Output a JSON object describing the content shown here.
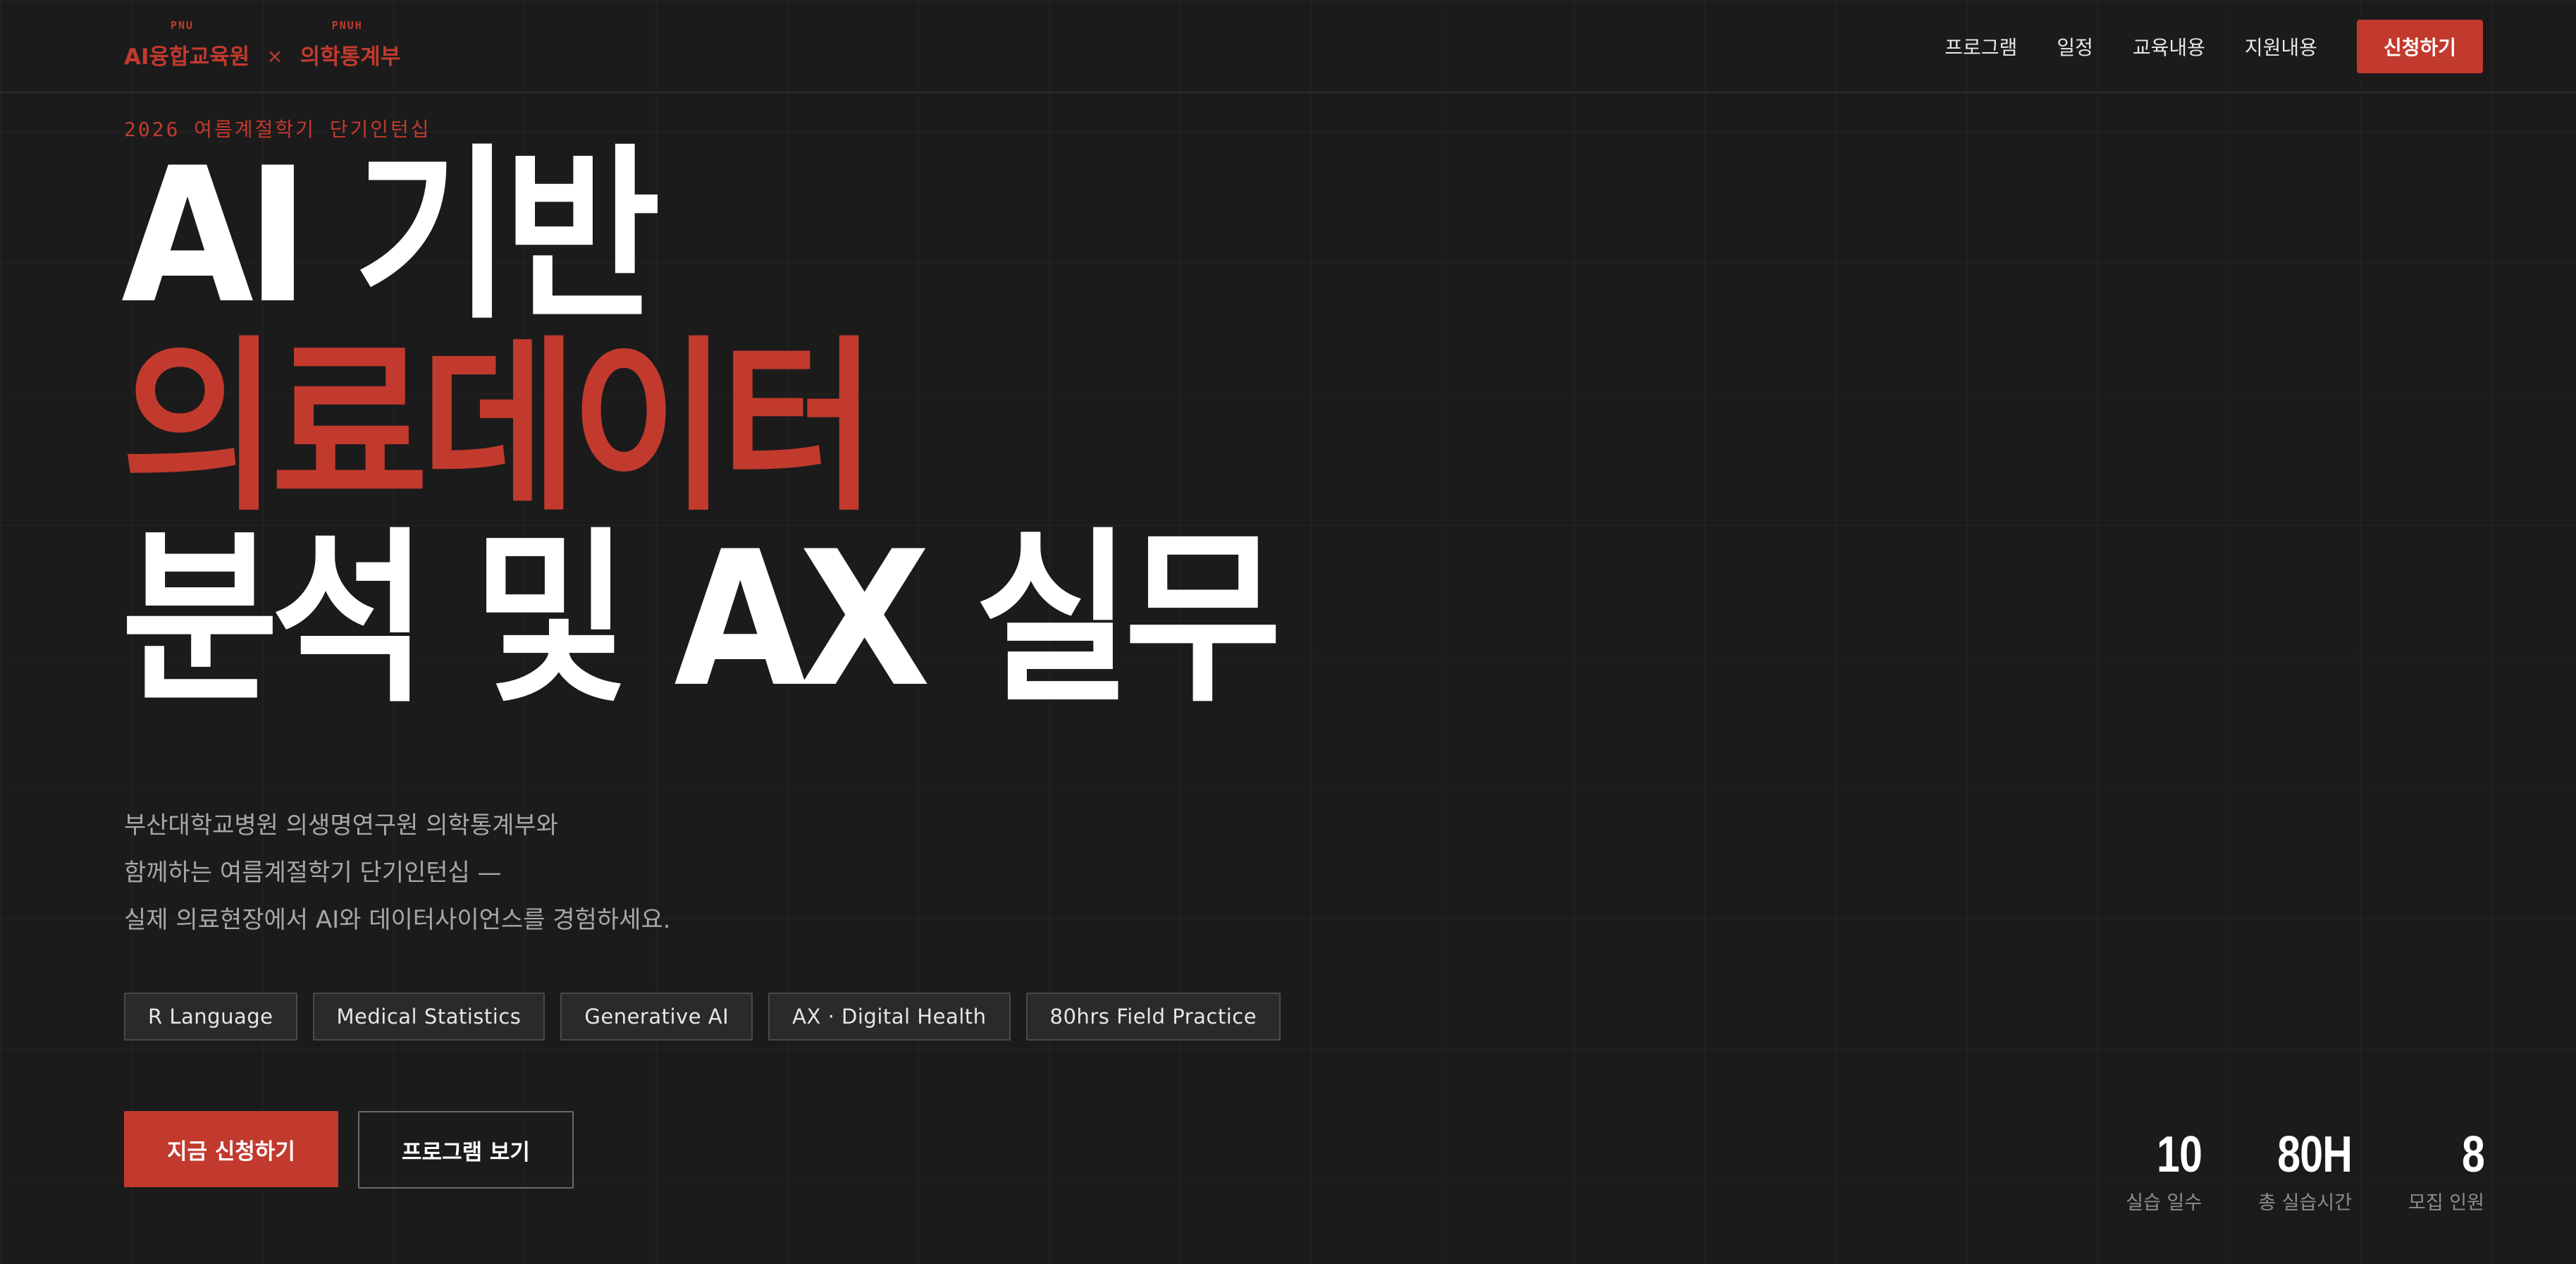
{
  "header": {
    "logo": {
      "left_tag": "PNU",
      "left_name": "AI융합교육원",
      "separator": "×",
      "right_tag": "PNUH",
      "right_name": "의학통계부"
    },
    "nav": {
      "items": [
        "프로그램",
        "일정",
        "교육내용",
        "지원내용"
      ],
      "apply_label": "신청하기"
    }
  },
  "hero": {
    "eyebrow": "2026 여름계절학기 단기인턴십",
    "title_line1": "AI 기반",
    "title_line2": "의료데이터",
    "title_line3": "분석 및 AX 실무",
    "description": [
      "부산대학교병원 의생명연구원 의학통계부와",
      "함께하는 여름계절학기 단기인턴십 —",
      "실제 의료현장에서 AI와 데이터사이언스를 경험하세요."
    ],
    "tags": [
      "R Language",
      "Medical Statistics",
      "Generative AI",
      "AX · Digital Health",
      "80hrs Field Practice"
    ],
    "primary_button": "지금 신청하기",
    "secondary_button": "프로그램 보기"
  },
  "stats": [
    {
      "value": "10",
      "label": "실습 일수"
    },
    {
      "value": "80H",
      "label": "총 실습시간"
    },
    {
      "value": "8",
      "label": "모집 인원"
    }
  ],
  "colors": {
    "background": "#1c1c1c",
    "accent": "#c23a2e",
    "text": "#ffffff",
    "muted": "#a8a8a8"
  }
}
